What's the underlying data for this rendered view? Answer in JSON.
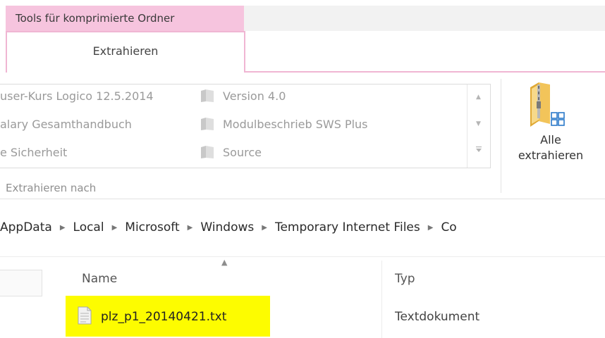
{
  "ribbon": {
    "context_tab_header": "Tools für komprimierte Ordner",
    "active_tab": "Extrahieren",
    "gallery": {
      "col1": [
        "user-Kurs Logico 12.5.2014",
        "alary Gesamthandbuch",
        "e Sicherheit"
      ],
      "col2": [
        "Version 4.0",
        "Modulbeschrieb SWS Plus",
        "Source"
      ]
    },
    "group_label": "Extrahieren nach",
    "extract_all": {
      "line1": "Alle",
      "line2": "extrahieren"
    },
    "colors": {
      "context_header": "#f6c4de",
      "tab_border": "#f0b6d3"
    }
  },
  "address_bar": {
    "crumbs": [
      "AppData",
      "Local",
      "Microsoft",
      "Windows",
      "Temporary Internet Files",
      "Co"
    ]
  },
  "file_list": {
    "columns": {
      "name": "Name",
      "type": "Typ"
    },
    "rows": [
      {
        "name": "plz_p1_20140421.txt",
        "type": "Textdokument",
        "icon": "text-file-icon",
        "highlight": "#fdfc00"
      }
    ]
  }
}
